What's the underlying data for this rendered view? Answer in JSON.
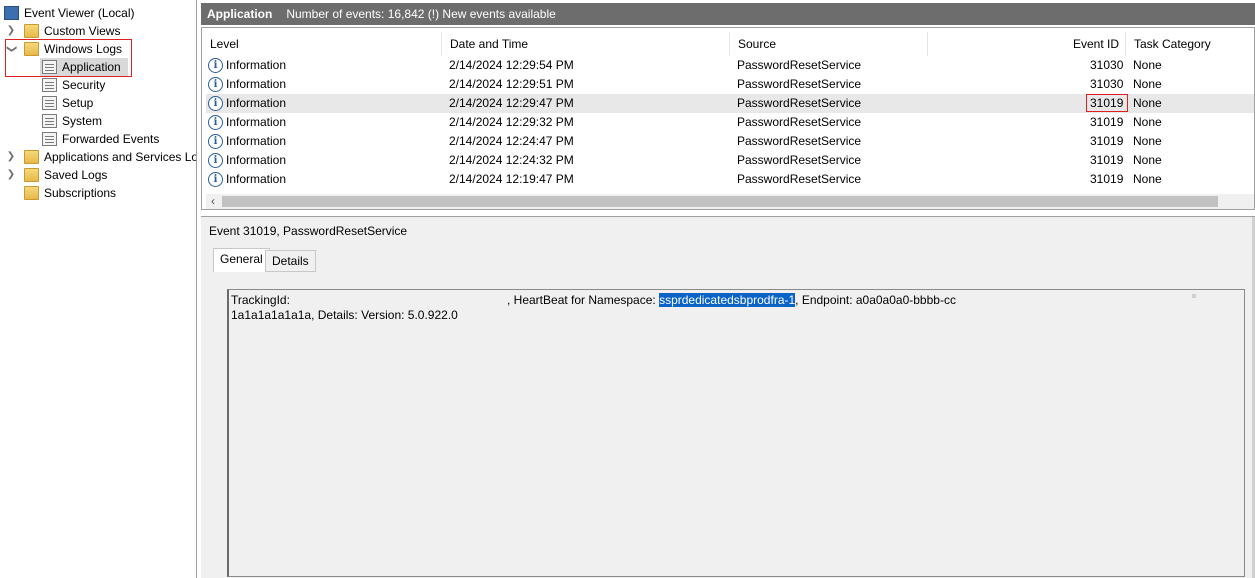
{
  "tree": {
    "root": "Event Viewer (Local)",
    "custom_views": "Custom Views",
    "windows_logs": "Windows Logs",
    "application": "Application",
    "security": "Security",
    "setup": "Setup",
    "system": "System",
    "forwarded_events": "Forwarded Events",
    "apps_services": "Applications and Services Lo",
    "saved_logs": "Saved Logs",
    "subscriptions": "Subscriptions"
  },
  "header": {
    "log_name": "Application",
    "summary": "Number of events: 16,842 (!) New events available"
  },
  "list": {
    "columns": [
      "Level",
      "Date and Time",
      "Source",
      "Event ID",
      "Task Category"
    ],
    "rows": [
      {
        "level": "Information",
        "date": "2/14/2024 12:29:54 PM",
        "source": "PasswordResetService",
        "event_id": "31030",
        "task": "None"
      },
      {
        "level": "Information",
        "date": "2/14/2024 12:29:51 PM",
        "source": "PasswordResetService",
        "event_id": "31030",
        "task": "None"
      },
      {
        "level": "Information",
        "date": "2/14/2024 12:29:47 PM",
        "source": "PasswordResetService",
        "event_id": "31019",
        "task": "None"
      },
      {
        "level": "Information",
        "date": "2/14/2024 12:29:32 PM",
        "source": "PasswordResetService",
        "event_id": "31019",
        "task": "None"
      },
      {
        "level": "Information",
        "date": "2/14/2024 12:24:47 PM",
        "source": "PasswordResetService",
        "event_id": "31019",
        "task": "None"
      },
      {
        "level": "Information",
        "date": "2/14/2024 12:24:32 PM",
        "source": "PasswordResetService",
        "event_id": "31019",
        "task": "None"
      },
      {
        "level": "Information",
        "date": "2/14/2024 12:19:47 PM",
        "source": "PasswordResetService",
        "event_id": "31019",
        "task": "None"
      }
    ]
  },
  "detail": {
    "title": "Event 31019, PasswordResetService",
    "tab_general": "General",
    "tab_details": "Details",
    "desc_tracking": "TrackingId:",
    "desc_heartbeat": ", HeartBeat for Namespace: ",
    "desc_namespace": "ssprdedicatedsbprodfra-1",
    "desc_endpoint": ", Endpoint: a0a0a0a0-bbbb-cc",
    "desc_line2": "1a1a1a1a1a1a, Details: Version: 5.0.922.0"
  },
  "colors": {
    "highlight": "#0a64c8",
    "callout": "#e02020",
    "header_bar": "#6d6d6d"
  }
}
